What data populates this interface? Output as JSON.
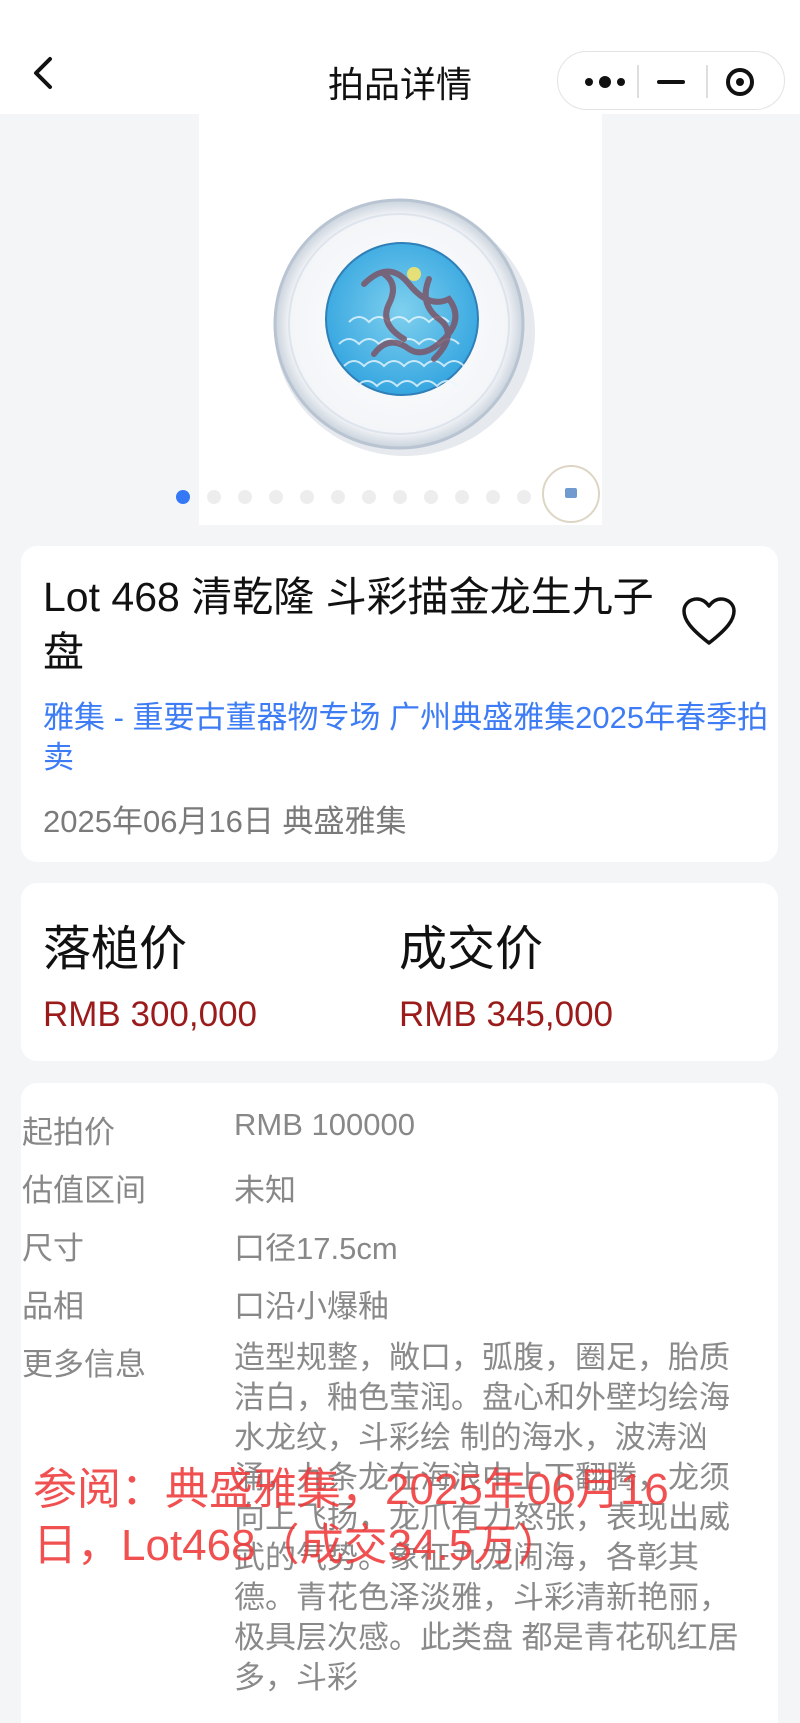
{
  "nav": {
    "title": "拍品详情"
  },
  "gallery": {
    "total_images": 12,
    "active_index": 0
  },
  "lot": {
    "title": "Lot 468 清乾隆 斗彩描金龙生九子盘",
    "session": "雅集 - 重要古董器物专场 广州典盛雅集2025年春季拍卖",
    "date_house": "2025年06月16日 典盛雅集"
  },
  "prices": {
    "hammer_label": "落槌价",
    "hammer_value": "RMB 300,000",
    "final_label": "成交价",
    "final_value": "RMB 345,000"
  },
  "details": {
    "start_label": "起拍价",
    "start_value": "RMB 100000",
    "estimate_label": "估值区间",
    "estimate_value": "未知",
    "size_label": "尺寸",
    "size_value": "口径17.5cm",
    "condition_label": "品相",
    "condition_value": "口沿小爆釉",
    "more_label": "更多信息",
    "more_value": "造型规整，敞口，弧腹，圈足，胎质洁白，釉色莹润。盘心和外壁均绘海水龙纹，斗彩绘 制的海水，波涛汹涌，九条龙在海浪中上下翻腾，龙须向上飞扬，龙爪有力怒张，表现出威武的气势。象征九龙闹海，各彰其德。青花色泽淡雅，斗彩清新艳丽，极具层次感。此类盘 都是青花矾红居多，斗彩"
  },
  "watermark": {
    "text": "参阅：典盛雅集，2025年06月16日，Lot468（成交34.5万）"
  },
  "colors": {
    "link": "#3d7cf4",
    "price": "#9b1b1b",
    "watermark": "#f0393a",
    "pager_active": "#3478f6"
  }
}
